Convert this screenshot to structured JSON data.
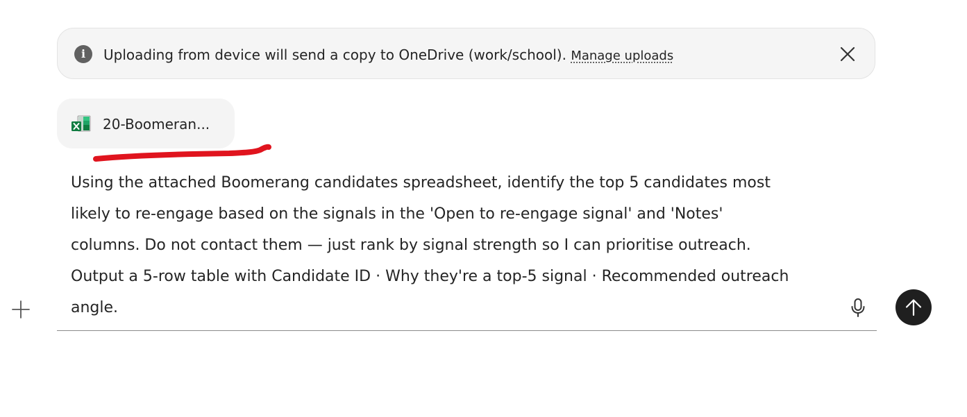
{
  "banner": {
    "message": "Uploading from device will send a copy to OneDrive (work/school).",
    "manage_link": "Manage uploads",
    "icon": "info-icon",
    "close_icon": "close-icon"
  },
  "attachment": {
    "file_name": "20-Boomeran...",
    "icon": "excel-file-icon"
  },
  "prompt": {
    "lines": [
      "Using the attached Boomerang candidates spreadsheet, identify the top 5 candidates most",
      "likely to re-engage based on the signals in the 'Open to re-engage signal' and 'Notes'",
      "columns. Do not contact them — just rank by signal strength so I can prioritise outreach.",
      "Output a 5-row table with Candidate ID · Why they're a top-5 signal · Recommended outreach",
      "angle."
    ]
  },
  "controls": {
    "plus_icon": "plus-icon",
    "mic_icon": "microphone-icon",
    "send_icon": "arrow-up-icon"
  },
  "colors": {
    "banner_bg": "#f5f5f5",
    "chip_bg": "#f4f4f4",
    "send_bg": "#1f1f1f",
    "annotation_red": "#e0141e",
    "excel_green": "#21a366"
  }
}
